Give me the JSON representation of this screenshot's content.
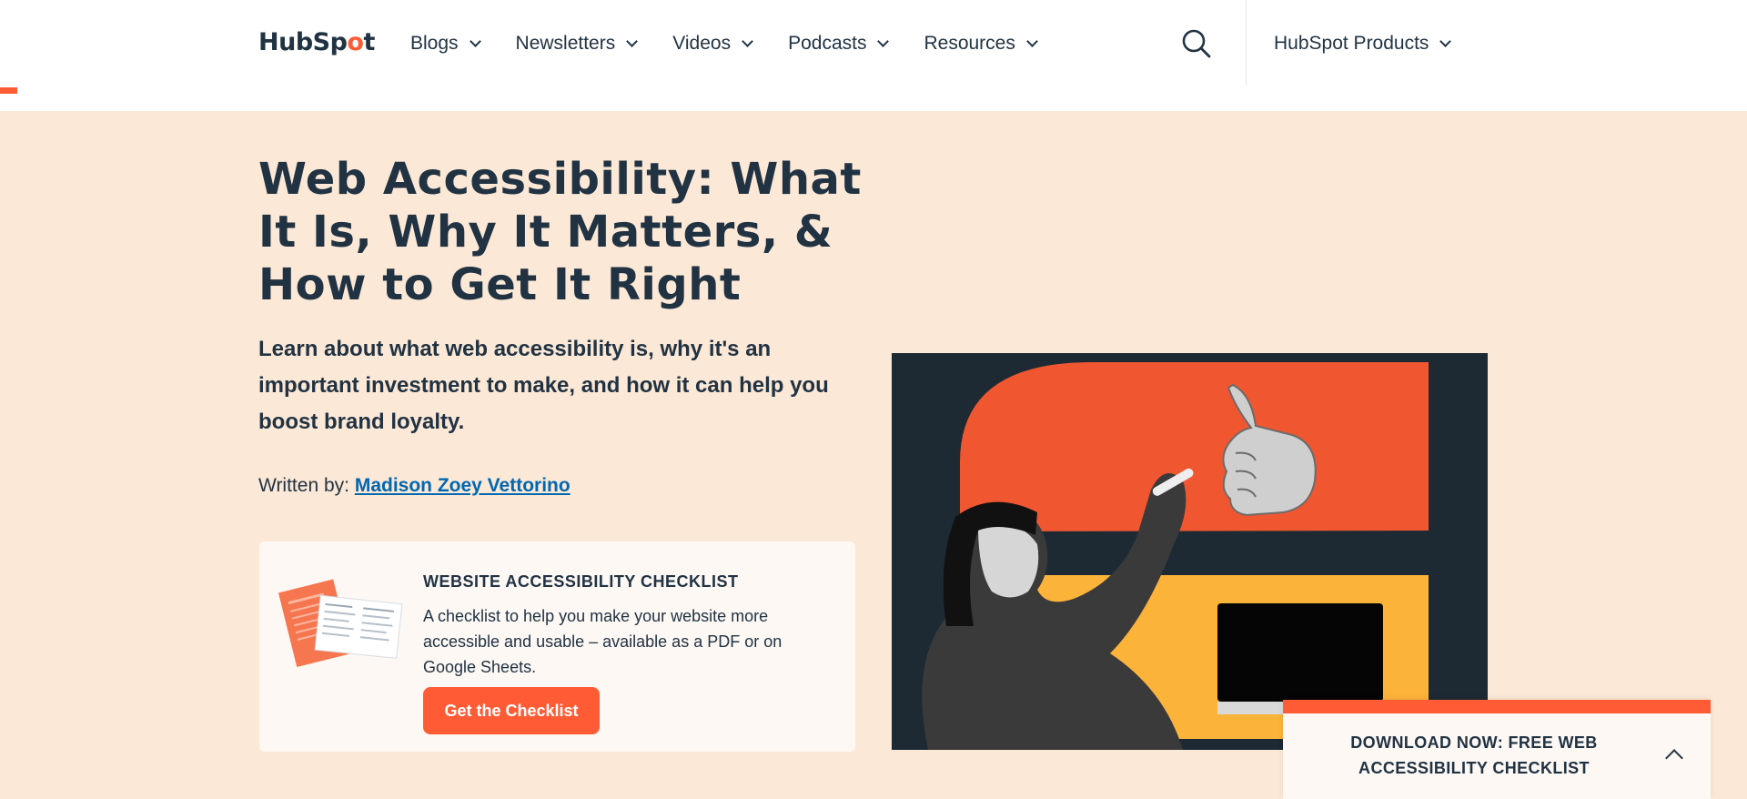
{
  "header": {
    "logo": {
      "part1": "HubSp",
      "accent": "o",
      "part2": "t"
    },
    "nav": [
      {
        "label": "Blogs"
      },
      {
        "label": "Newsletters"
      },
      {
        "label": "Videos"
      },
      {
        "label": "Podcasts"
      },
      {
        "label": "Resources"
      }
    ],
    "search_icon": "search-icon",
    "products_label": "HubSpot Products"
  },
  "article": {
    "title": "Web Accessibility: What It Is, Why It Matters, & How to Get It Right",
    "subtitle": "Learn about what web accessibility is, why it's an important investment to make, and how it can help you boost brand loyalty.",
    "author_prefix": "Written by:",
    "author_name": "Madison Zoey Vettorino"
  },
  "checklist_card": {
    "heading": "WEBSITE ACCESSIBILITY CHECKLIST",
    "description": "A checklist to help you make your website more accessible and usable – available as a PDF or on Google Sheets.",
    "button_label": "Get the Checklist"
  },
  "sticky_banner": {
    "text": "DOWNLOAD NOW: FREE WEB ACCESSIBILITY CHECKLIST",
    "icon": "chevron-up-icon"
  },
  "colors": {
    "brand_orange": "#ff5c35",
    "navy": "#213343",
    "hero_bg": "#fce8d6",
    "link_blue": "#0068b1",
    "yellow": "#fcb33a"
  }
}
